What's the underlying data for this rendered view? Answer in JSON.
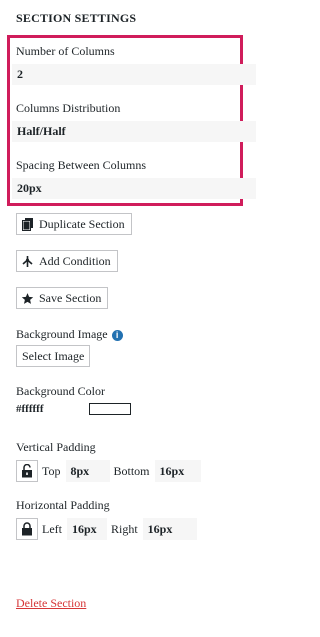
{
  "panel": {
    "title": "SECTION SETTINGS"
  },
  "fields": {
    "columns_label": "Number of Columns",
    "columns_value": "2",
    "distribution_label": "Columns Distribution",
    "distribution_value": "Half/Half",
    "spacing_label": "Spacing Between Columns",
    "spacing_value": "20px"
  },
  "actions": {
    "duplicate": "Duplicate Section",
    "add_condition": "Add Condition",
    "save": "Save Section"
  },
  "background_image": {
    "label": "Background Image",
    "button": "Select Image",
    "info_icon": "i"
  },
  "background_color": {
    "label": "Background Color",
    "value": "#ffffff"
  },
  "vertical_padding": {
    "label": "Vertical Padding",
    "top_label": "Top",
    "top_value": "8px",
    "bottom_label": "Bottom",
    "bottom_value": "16px",
    "lock_state": "unlocked"
  },
  "horizontal_padding": {
    "label": "Horizontal Padding",
    "left_label": "Left",
    "left_value": "16px",
    "right_label": "Right",
    "right_value": "16px",
    "lock_state": "locked"
  },
  "footer": {
    "delete": "Delete Section"
  },
  "colors": {
    "highlight": "#d01c5b",
    "delete_link": "#d63638",
    "info_icon": "#2271b1"
  }
}
